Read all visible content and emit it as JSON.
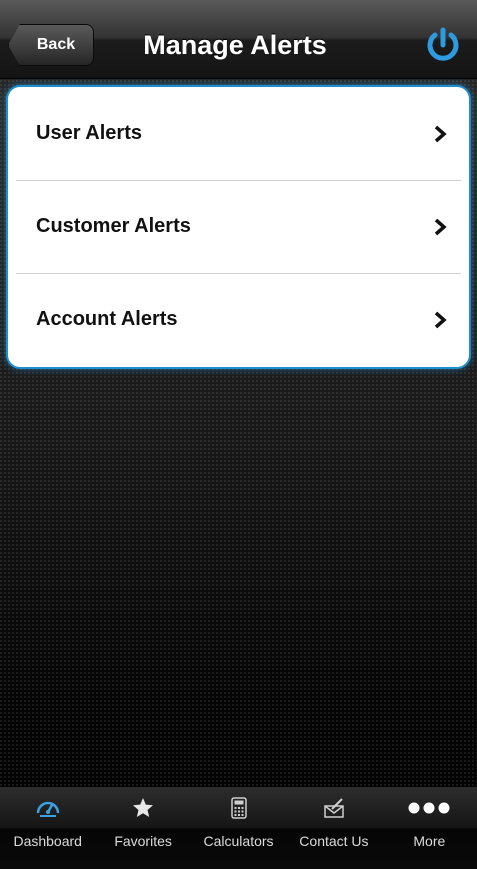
{
  "navbar": {
    "back_label": "Back",
    "title": "Manage Alerts",
    "power_icon": "power-icon"
  },
  "alerts": {
    "items": [
      {
        "label": "User Alerts"
      },
      {
        "label": "Customer Alerts"
      },
      {
        "label": "Account Alerts"
      }
    ],
    "accent_color": "#1d8fcf"
  },
  "tabbar": {
    "tabs": [
      {
        "label": "Dashboard",
        "icon": "gauge-icon"
      },
      {
        "label": "Favorites",
        "icon": "star-icon"
      },
      {
        "label": "Calculators",
        "icon": "calculator-icon"
      },
      {
        "label": "Contact Us",
        "icon": "mail-icon"
      },
      {
        "label": "More",
        "icon": "more-icon"
      }
    ]
  }
}
